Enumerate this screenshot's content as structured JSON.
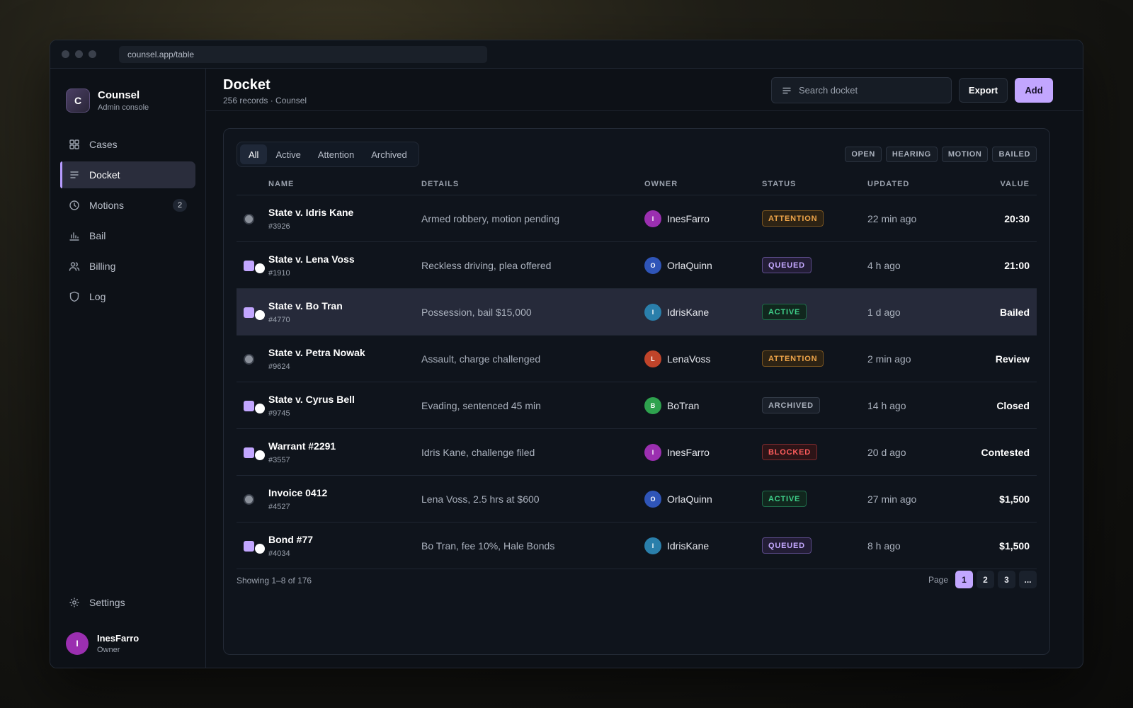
{
  "browser": {
    "url": "counsel.app/table"
  },
  "brand": {
    "initial": "C",
    "name": "Counsel",
    "subtitle": "Admin console"
  },
  "sidebar": {
    "items": [
      {
        "label": "Cases",
        "icon": "grid-icon"
      },
      {
        "label": "Docket",
        "icon": "list-icon",
        "active": true
      },
      {
        "label": "Motions",
        "icon": "clock-icon",
        "badge": "2"
      },
      {
        "label": "Bail",
        "icon": "bar-chart-icon"
      },
      {
        "label": "Billing",
        "icon": "users-icon"
      },
      {
        "label": "Log",
        "icon": "shield-icon"
      }
    ],
    "settings_label": "Settings",
    "user": {
      "initial": "I",
      "name": "InesFarro",
      "role": "Owner"
    }
  },
  "header": {
    "title": "Docket",
    "subtitle": "256 records · Counsel",
    "search_placeholder": "Search docket",
    "export_label": "Export",
    "add_label": "Add"
  },
  "tabs": [
    "All",
    "Active",
    "Attention",
    "Archived"
  ],
  "filters": [
    "OPEN",
    "HEARING",
    "MOTION",
    "BAILED"
  ],
  "columns": {
    "name": "NAME",
    "details": "DETAILS",
    "owner": "OWNER",
    "status": "STATUS",
    "updated": "UPDATED",
    "value": "VALUE"
  },
  "rows": [
    {
      "name": "State v. Idris Kane",
      "code": "#3926",
      "details": "Armed robbery, motion pending",
      "owner": "InesFarro",
      "owner_initial": "I",
      "avatar_color": "#9b2fb0",
      "status": "ATTENTION",
      "updated": "22 min ago",
      "value": "20:30",
      "selected": false,
      "checked": false
    },
    {
      "name": "State v. Lena Voss",
      "code": "#1910",
      "details": "Reckless driving, plea offered",
      "owner": "OrlaQuinn",
      "owner_initial": "O",
      "avatar_color": "#2f55b8",
      "status": "QUEUED",
      "updated": "4 h ago",
      "value": "21:00",
      "selected": false,
      "checked": true
    },
    {
      "name": "State v. Bo Tran",
      "code": "#4770",
      "details": "Possession, bail $15,000",
      "owner": "IdrisKane",
      "owner_initial": "I",
      "avatar_color": "#2a7fab",
      "status": "ACTIVE",
      "updated": "1 d ago",
      "value": "Bailed",
      "selected": true,
      "checked": true
    },
    {
      "name": "State v. Petra Nowak",
      "code": "#9624",
      "details": "Assault, charge challenged",
      "owner": "LenaVoss",
      "owner_initial": "L",
      "avatar_color": "#c0442a",
      "status": "ATTENTION",
      "updated": "2 min ago",
      "value": "Review",
      "selected": false,
      "checked": false
    },
    {
      "name": "State v. Cyrus Bell",
      "code": "#9745",
      "details": "Evading, sentenced 45 min",
      "owner": "BoTran",
      "owner_initial": "B",
      "avatar_color": "#2ea24e",
      "status": "ARCHIVED",
      "updated": "14 h ago",
      "value": "Closed",
      "selected": false,
      "checked": true
    },
    {
      "name": "Warrant #2291",
      "code": "#3557",
      "details": "Idris Kane, challenge filed",
      "owner": "InesFarro",
      "owner_initial": "I",
      "avatar_color": "#9b2fb0",
      "status": "BLOCKED",
      "updated": "20 d ago",
      "value": "Contested",
      "selected": false,
      "checked": true
    },
    {
      "name": "Invoice 0412",
      "code": "#4527",
      "details": "Lena Voss, 2.5 hrs at $600",
      "owner": "OrlaQuinn",
      "owner_initial": "O",
      "avatar_color": "#2f55b8",
      "status": "ACTIVE",
      "updated": "27 min ago",
      "value": "$1,500",
      "selected": false,
      "checked": false
    },
    {
      "name": "Bond #77",
      "code": "#4034",
      "details": "Bo Tran, fee 10%, Hale Bonds",
      "owner": "IdrisKane",
      "owner_initial": "I",
      "avatar_color": "#2a7fab",
      "status": "QUEUED",
      "updated": "8 h ago",
      "value": "$1,500",
      "selected": false,
      "checked": true
    }
  ],
  "status_colors": {
    "ATTENTION": {
      "fg": "#f0a64a",
      "bg": "#2d2314",
      "border": "#7a5520"
    },
    "QUEUED": {
      "fg": "#c4a8ff",
      "bg": "#231d36",
      "border": "#5d4c8c"
    },
    "ACTIVE": {
      "fg": "#3fd08a",
      "bg": "#11271e",
      "border": "#1f6b49"
    },
    "ARCHIVED": {
      "fg": "#aab1bd",
      "bg": "#1a202a",
      "border": "#333b48"
    },
    "BLOCKED": {
      "fg": "#ff5d5d",
      "bg": "#2d1417",
      "border": "#7a2a2e"
    }
  },
  "footer": {
    "showing": "Showing 1–8 of 176",
    "page_label": "Page",
    "pages": [
      "1",
      "2",
      "3",
      "..."
    ],
    "current_page": "1"
  },
  "accent": "#c2a6ff"
}
